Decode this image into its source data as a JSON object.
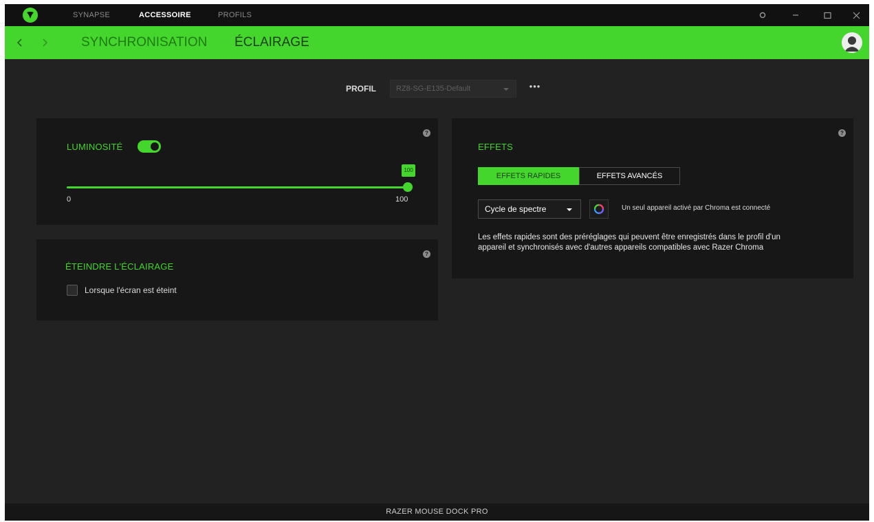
{
  "topnav": {
    "tabs": [
      {
        "label": "SYNAPSE"
      },
      {
        "label": "ACCESSOIRE"
      },
      {
        "label": "PROFILS"
      }
    ]
  },
  "subnav": {
    "tabs": [
      {
        "label": "SYNCHRONISATION"
      },
      {
        "label": "ÉCLAIRAGE"
      }
    ]
  },
  "profile": {
    "label": "PROFIL",
    "selected": "RZ8-SG-E135-Default",
    "more": "•••"
  },
  "brightness": {
    "title": "LUMINOSITÉ",
    "enabled": true,
    "value_label": "100",
    "value": 100,
    "min_label": "0",
    "max_label": "100"
  },
  "lighting_off": {
    "title": "ÉTEINDRE L'ÉCLAIRAGE",
    "option_label": "Lorsque l'écran est éteint",
    "checked": false
  },
  "effects": {
    "title": "EFFETS",
    "tabs": [
      {
        "label": "EFFETS RAPIDES",
        "active": true
      },
      {
        "label": "EFFETS AVANCÉS",
        "active": false
      }
    ],
    "selected_effect": "Cycle de spectre",
    "chroma_status": "Un seul appareil activé par Chroma est connecté",
    "description": "Les effets rapides sont des préréglages qui peuvent être enregistrés dans le profil d'un appareil et synchronisés avec d'autres appareils compatibles avec Razer Chroma"
  },
  "footer": {
    "device_name": "RAZER MOUSE DOCK PRO"
  },
  "colors": {
    "accent": "#44d62c",
    "background": "#222222",
    "panel": "#171717"
  }
}
